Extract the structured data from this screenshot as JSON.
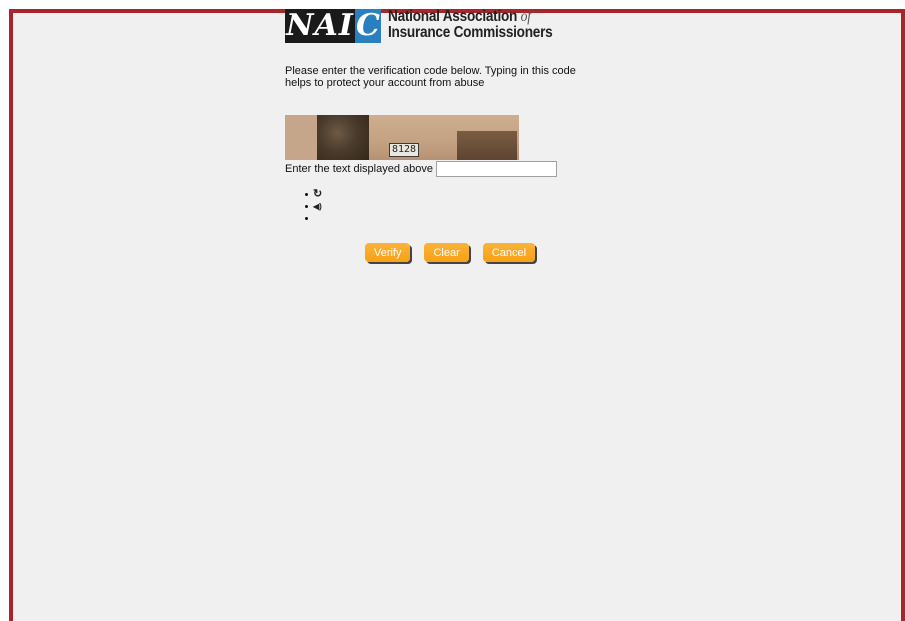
{
  "logo": {
    "mark_left": "NAI",
    "mark_right": "C",
    "line1": "National Association",
    "line1_of": "of",
    "line2": "Insurance Commissioners"
  },
  "message": "Please enter the verification code below. Typing in this code helps to protect your account from abuse",
  "captcha": {
    "plaque_text": "8128"
  },
  "entry": {
    "label": "Enter the text displayed above",
    "value": "",
    "placeholder": ""
  },
  "tools": {
    "refresh_icon": "↻",
    "audio_icon": "◀)"
  },
  "buttons": {
    "verify": "Verify",
    "clear": "Clear",
    "cancel": "Cancel"
  },
  "colors": {
    "frame_border": "#a8262b",
    "button": "#f7a114",
    "logo_blue": "#2a7fc0"
  }
}
